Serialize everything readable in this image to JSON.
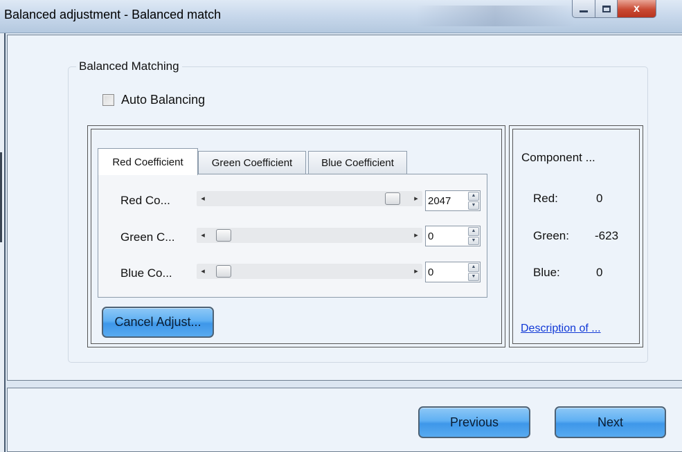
{
  "window": {
    "title": "Balanced adjustment - Balanced match",
    "close_glyph": "x"
  },
  "group": {
    "legend": "Balanced Matching",
    "auto_balancing_label": "Auto Balancing",
    "auto_balancing_checked": false
  },
  "tabs": [
    {
      "label": "Red Coefficient",
      "active": true
    },
    {
      "label": "Green Coefficient",
      "active": false
    },
    {
      "label": "Blue Coefficient",
      "active": false
    }
  ],
  "sliders": [
    {
      "label": "Red Co...",
      "value": "2047",
      "fraction": 1.0
    },
    {
      "label": "Green C...",
      "value": "0",
      "fraction": 0.0
    },
    {
      "label": "Blue Co...",
      "value": "0",
      "fraction": 0.0
    }
  ],
  "cancel_adjust_label": "Cancel Adjust...",
  "component": {
    "title": "Component ...",
    "rows": [
      {
        "label": "Red:",
        "value": "0"
      },
      {
        "label": "Green:",
        "value": "-623"
      },
      {
        "label": "Blue:",
        "value": "0"
      }
    ],
    "description_link": "Description of ..."
  },
  "footer": {
    "previous_label": "Previous",
    "next_label": "Next"
  },
  "icons": {
    "slider_left": "◂",
    "slider_right": "▸",
    "spin_up": "▲",
    "spin_down": "▼"
  },
  "colors": {
    "button_blue": "#5fb0f3",
    "link_blue": "#1038d6",
    "close_red": "#c94a33"
  }
}
